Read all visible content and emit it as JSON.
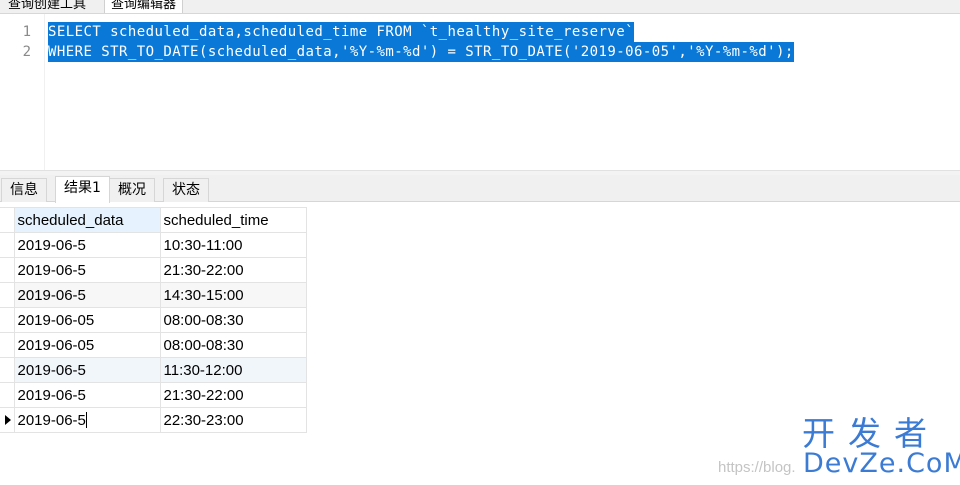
{
  "top_tabs": [
    "查询创建工具",
    "查询编辑器"
  ],
  "editor": {
    "line_numbers": [
      "1",
      "2"
    ],
    "lines": [
      "SELECT scheduled_data,scheduled_time FROM `t_healthy_site_reserve`",
      "WHERE STR_TO_DATE(scheduled_data,'%Y-%m-%d') = STR_TO_DATE('2019-06-05','%Y-%m-%d');"
    ],
    "selection_color": "#0a78d7"
  },
  "result_tabs": [
    "信息",
    "结果1",
    "概况",
    "状态"
  ],
  "active_result_tab": "结果1",
  "grid": {
    "columns": [
      "scheduled_data",
      "scheduled_time"
    ],
    "rows": [
      [
        "2019-06-5",
        "10:30-11:00"
      ],
      [
        "2019-06-5",
        "21:30-22:00"
      ],
      [
        "2019-06-5",
        "14:30-15:00"
      ],
      [
        "2019-06-05",
        "08:00-08:30"
      ],
      [
        "2019-06-05",
        "08:00-08:30"
      ],
      [
        "2019-06-5",
        "11:30-12:00"
      ],
      [
        "2019-06-5",
        "21:30-22:00"
      ],
      [
        "2019-06-5",
        "22:30-23:00"
      ]
    ],
    "current_row_marker": "row-pointer-icon"
  },
  "watermark": {
    "url": "https://blog.",
    "cn": "开发者",
    "en": "DevZe.CoM"
  }
}
